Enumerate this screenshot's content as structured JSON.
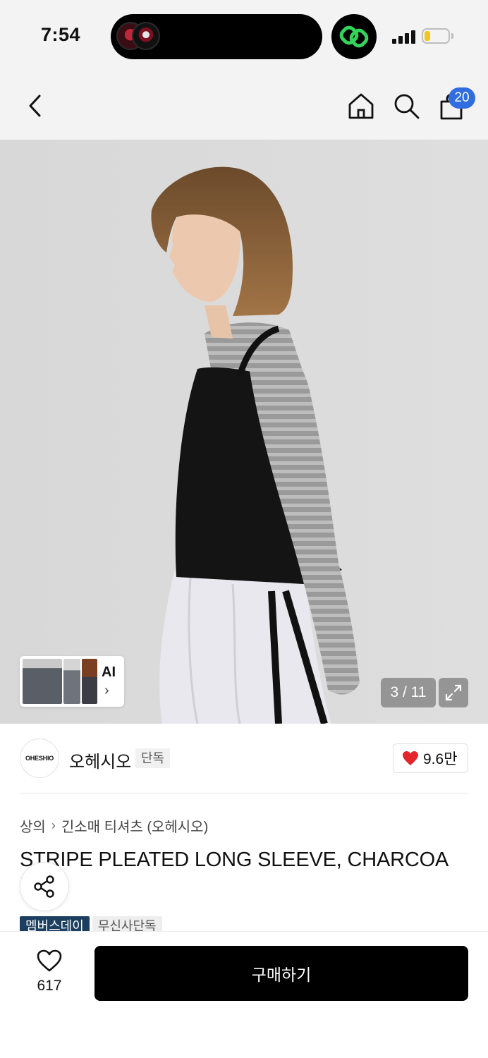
{
  "status_bar": {
    "time": "7:54"
  },
  "nav": {
    "cart_count": "20"
  },
  "gallery": {
    "ai_label": "AI",
    "counter": "3 / 11"
  },
  "brand": {
    "logo_text": "OHESHIO",
    "name": "오헤시오",
    "exclusive_tag": "단독",
    "like_count": "9.6만"
  },
  "breadcrumb": {
    "category": "상의",
    "subcategory": "긴소매 티셔츠 (오헤시오)"
  },
  "product": {
    "title": "STRIPE PLEATED LONG SLEEVE, CHARCOA",
    "tags": [
      "멤버스데이",
      "무신사단독"
    ]
  },
  "bottom_bar": {
    "wish_count": "617",
    "buy_label": "구매하기"
  },
  "colors": {
    "accent_blue": "#2f6de1",
    "heart_red": "#e3262b",
    "member_tag": "#1c3e5f",
    "buy_button": "#000000"
  },
  "icons": [
    "back-icon",
    "home-icon",
    "search-icon",
    "shopping-bag-icon",
    "expand-icon",
    "heart-icon",
    "share-icon"
  ]
}
